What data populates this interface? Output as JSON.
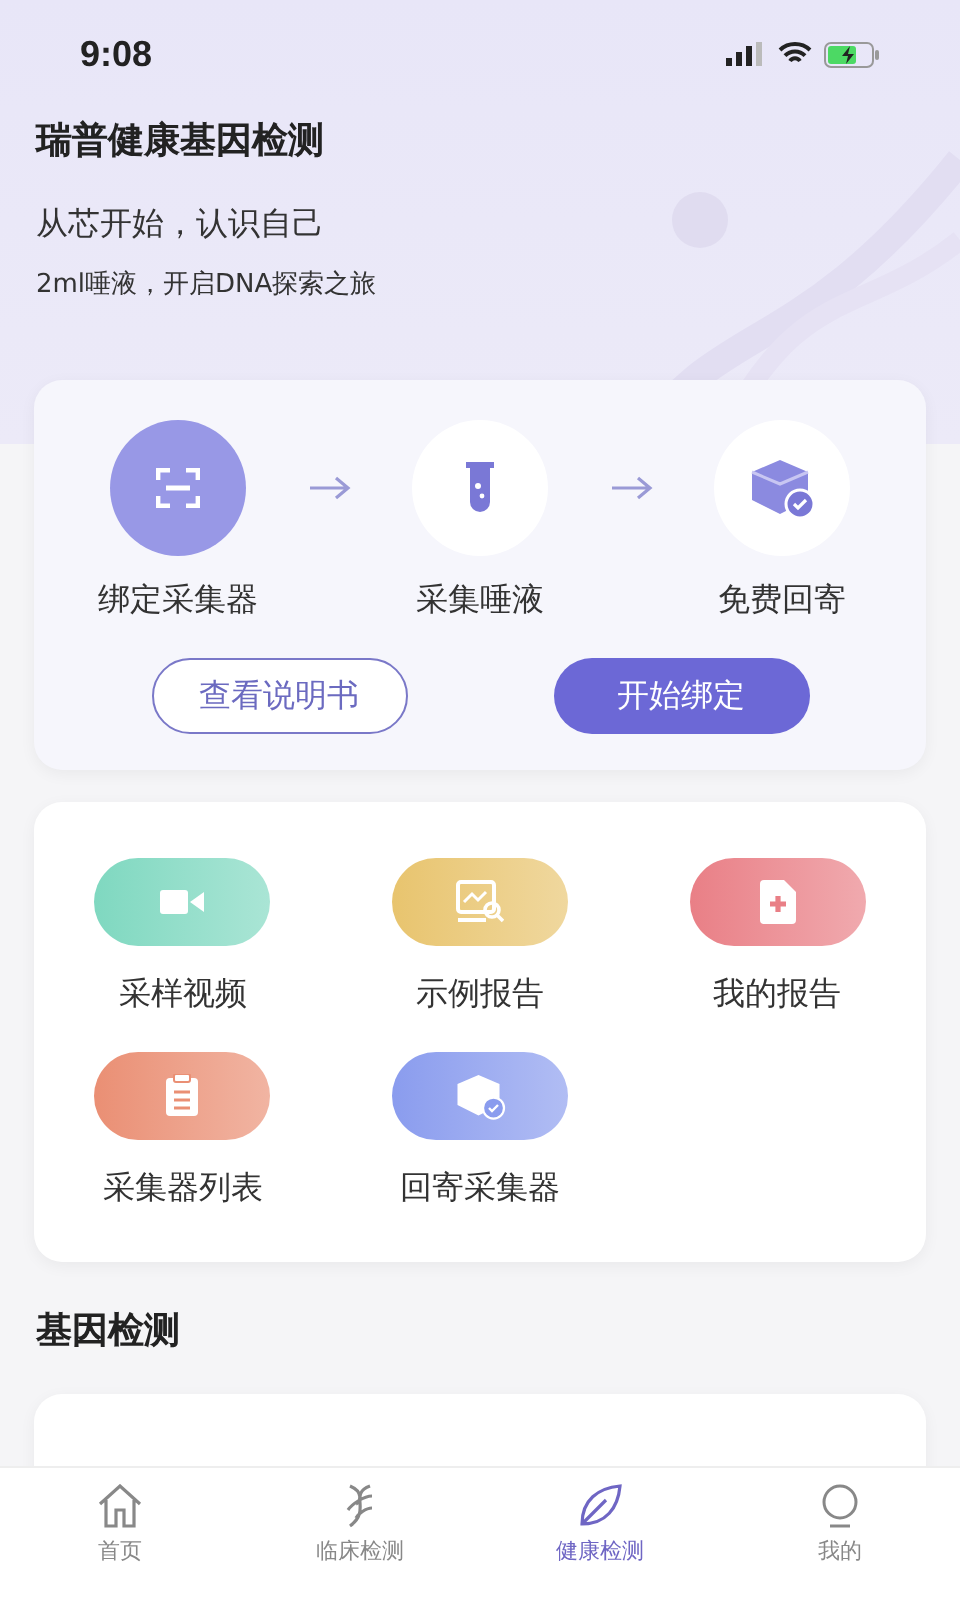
{
  "status_bar": {
    "time": "9:08"
  },
  "header": {
    "title": "瑞普健康基因检测",
    "slogan": "从芯开始，认识自己",
    "subtitle": "2ml唾液，开启DNA探索之旅"
  },
  "steps": [
    {
      "label": "绑定采集器",
      "kind": "scan",
      "selected": true
    },
    {
      "label": "采集唾液",
      "kind": "tube",
      "selected": false
    },
    {
      "label": "免费回寄",
      "kind": "box",
      "selected": false
    }
  ],
  "step_buttons": [
    {
      "label": "查看说明书",
      "kind": "outline"
    },
    {
      "label": "开始绑定",
      "kind": "filled"
    }
  ],
  "shortcuts": [
    {
      "label": "采样视频",
      "kind": "video",
      "color": "#7fd8c0"
    },
    {
      "label": "示例报告",
      "kind": "report",
      "color": "#e8c46e"
    },
    {
      "label": "我的报告",
      "kind": "medical",
      "color": "#e97f86"
    },
    {
      "label": "采集器列表",
      "kind": "clipboard",
      "color": "#ea8f74"
    },
    {
      "label": "回寄采集器",
      "kind": "box",
      "color": "#8a9cee"
    }
  ],
  "section_title": "基因检测",
  "tabs": [
    {
      "label": "首页",
      "kind": "home",
      "selected": false
    },
    {
      "label": "临床检测",
      "kind": "dna",
      "selected": false
    },
    {
      "label": "健康检测",
      "kind": "leaf",
      "selected": true
    },
    {
      "label": "我的",
      "kind": "bulb",
      "selected": false
    }
  ]
}
